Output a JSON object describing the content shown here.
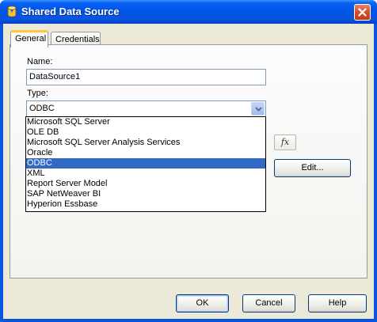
{
  "window": {
    "title": "Shared Data Source"
  },
  "tabs": [
    {
      "label": "General",
      "active": true
    },
    {
      "label": "Credentials",
      "active": false
    }
  ],
  "general": {
    "name_label": "Name:",
    "name_value": "DataSource1",
    "type_label": "Type:",
    "type_value": "ODBC",
    "type_options": [
      {
        "label": "Microsoft SQL Server",
        "selected": false
      },
      {
        "label": "OLE DB",
        "selected": false
      },
      {
        "label": "Microsoft SQL Server Analysis Services",
        "selected": false
      },
      {
        "label": "Oracle",
        "selected": false
      },
      {
        "label": "ODBC",
        "selected": true
      },
      {
        "label": "XML",
        "selected": false
      },
      {
        "label": "Report Server Model",
        "selected": false
      },
      {
        "label": "SAP NetWeaver BI",
        "selected": false
      },
      {
        "label": "Hyperion Essbase",
        "selected": false
      }
    ],
    "fx_label": "fx",
    "edit_label": "Edit..."
  },
  "footer": {
    "ok_label": "OK",
    "cancel_label": "Cancel",
    "help_label": "Help"
  },
  "colors": {
    "titlebar": "#0054e3",
    "selection": "#316ac5",
    "dialog_bg": "#ece9d8",
    "active_tab_accent": "#ffc83c"
  }
}
